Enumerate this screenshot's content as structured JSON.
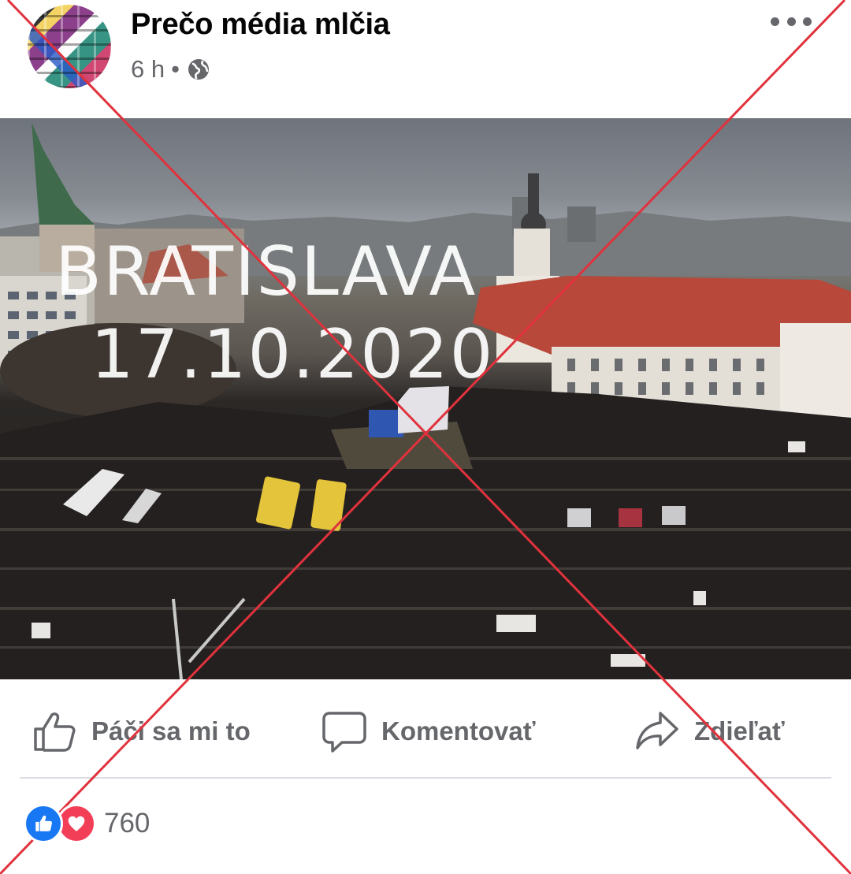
{
  "post": {
    "page_name": "Prečo média mlčia",
    "time": "6 h",
    "separator": "•",
    "privacy_icon": "globe-icon",
    "more_icon": "more-horizontal-icon"
  },
  "image": {
    "overlay_line1": "BRATISLAVA",
    "overlay_line2": "17.10.2020"
  },
  "actions": {
    "like_label": "Páči sa mi to",
    "comment_label": "Komentovať",
    "share_label": "Zdieľať"
  },
  "reactions": {
    "icons": [
      "like-icon",
      "love-icon"
    ],
    "count": "760"
  },
  "colors": {
    "cross": "#e0323c",
    "muted_text": "#65676b",
    "like_blue": "#1877f2",
    "love_red": "#f33e58"
  }
}
